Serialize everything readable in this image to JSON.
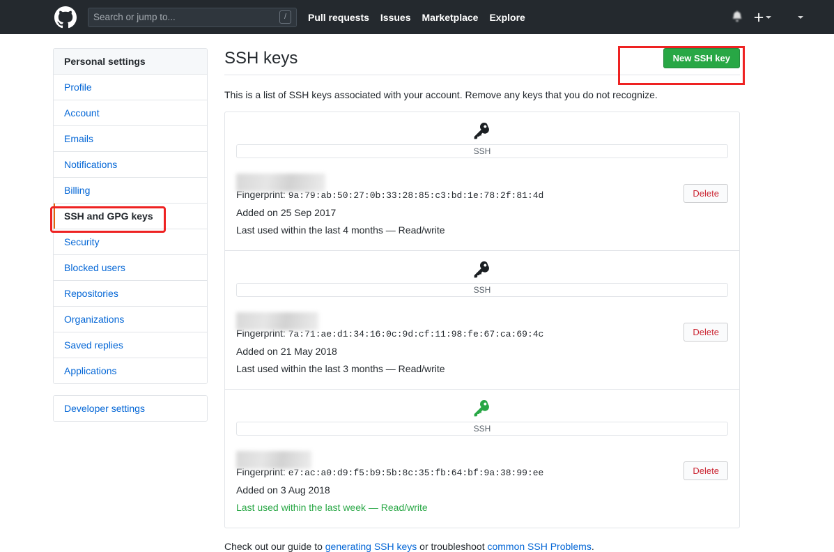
{
  "header": {
    "logo_icon": "github-mark-icon",
    "search": {
      "placeholder": "Search or jump to...",
      "shortcut_badge": "/"
    },
    "nav": [
      {
        "label": "Pull requests"
      },
      {
        "label": "Issues"
      },
      {
        "label": "Marketplace"
      },
      {
        "label": "Explore"
      }
    ],
    "notifications_icon": "bell-icon",
    "create_new_icon": "plus-icon",
    "create_new_caret": "chevron-down-icon",
    "profile_caret": "chevron-down-icon",
    "background_color": "#24292e"
  },
  "sidebar": {
    "heading": "Personal settings",
    "items": [
      {
        "label": "Profile",
        "selected": false
      },
      {
        "label": "Account",
        "selected": false
      },
      {
        "label": "Emails",
        "selected": false
      },
      {
        "label": "Notifications",
        "selected": false
      },
      {
        "label": "Billing",
        "selected": false
      },
      {
        "label": "SSH and GPG keys",
        "selected": true
      },
      {
        "label": "Security",
        "selected": false
      },
      {
        "label": "Blocked users",
        "selected": false
      },
      {
        "label": "Repositories",
        "selected": false
      },
      {
        "label": "Organizations",
        "selected": false
      },
      {
        "label": "Saved replies",
        "selected": false
      },
      {
        "label": "Applications",
        "selected": false
      }
    ],
    "developer_settings": "Developer settings"
  },
  "main": {
    "title": "SSH keys",
    "new_key_button": "New SSH key",
    "new_key_button_color": "#28a745",
    "intro": "This is a list of SSH keys associated with your account. Remove any keys that you do not recognize.",
    "badge_label": "SSH",
    "fingerprint_label": "Fingerprint:",
    "delete_button": "Delete",
    "keys": [
      {
        "icon": "key-icon",
        "icon_color": "#1b1f23",
        "title_redacted": true,
        "fingerprint": "9a:79:ab:50:27:0b:33:28:85:c3:bd:1e:78:2f:81:4d",
        "added": "Added on 25 Sep 2017",
        "last_used": "Last used within the last 4 months — Read/write",
        "last_used_recent": false
      },
      {
        "icon": "key-icon",
        "icon_color": "#1b1f23",
        "title_redacted": true,
        "fingerprint": "7a:71:ae:d1:34:16:0c:9d:cf:11:98:fe:67:ca:69:4c",
        "added": "Added on 21 May 2018",
        "last_used": "Last used within the last 3 months — Read/write",
        "last_used_recent": false
      },
      {
        "icon": "key-icon",
        "icon_color": "#28a745",
        "title_redacted": true,
        "fingerprint": "e7:ac:a0:d9:f5:b9:5b:8c:35:fb:64:bf:9a:38:99:ee",
        "added": "Added on 3 Aug 2018",
        "last_used": "Last used within the last week — Read/write",
        "last_used_recent": true
      }
    ],
    "footer": {
      "text_before": "Check out our guide to ",
      "link1": "generating SSH keys",
      "text_middle": " or troubleshoot ",
      "link2": "common SSH Problems",
      "text_after": "."
    }
  },
  "annotations": {
    "highlight_color": "#ee2222",
    "targets": [
      "SSH and GPG keys",
      "New SSH key"
    ]
  }
}
